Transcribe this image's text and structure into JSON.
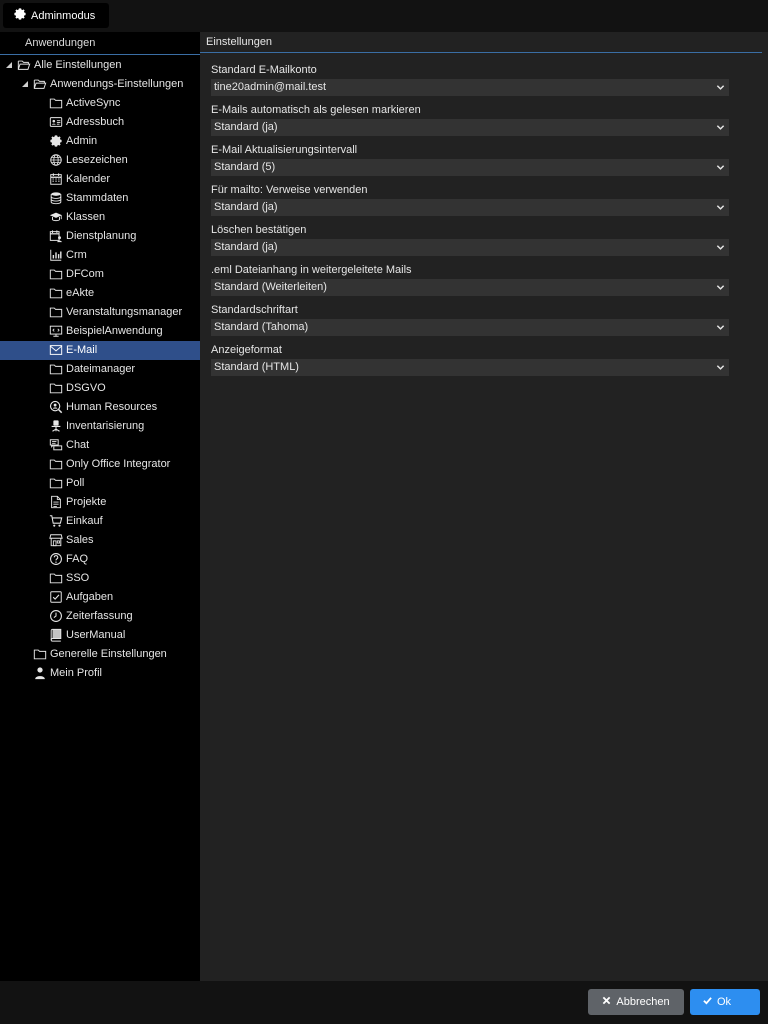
{
  "topbar": {
    "admin_mode_label": "Adminmodus"
  },
  "left_panel": {
    "header": "Anwendungen",
    "tree": [
      {
        "label": "Alle Einstellungen",
        "icon": "folder-open-icon",
        "level": 0,
        "toggle": "expanded"
      },
      {
        "label": "Anwendungs-Einstellungen",
        "icon": "folder-open-icon",
        "level": 1,
        "toggle": "expanded"
      },
      {
        "label": "ActiveSync",
        "icon": "folder-icon",
        "level": 2
      },
      {
        "label": "Adressbuch",
        "icon": "contact-card-icon",
        "level": 2
      },
      {
        "label": "Admin",
        "icon": "gear-icon",
        "level": 2
      },
      {
        "label": "Lesezeichen",
        "icon": "globe-icon",
        "level": 2
      },
      {
        "label": "Kalender",
        "icon": "calendar-icon",
        "level": 2
      },
      {
        "label": "Stammdaten",
        "icon": "database-icon",
        "level": 2
      },
      {
        "label": "Klassen",
        "icon": "graduation-cap-icon",
        "level": 2
      },
      {
        "label": "Dienstplanung",
        "icon": "calendar-person-icon",
        "level": 2
      },
      {
        "label": "Crm",
        "icon": "bar-chart-icon",
        "level": 2
      },
      {
        "label": "DFCom",
        "icon": "folder-icon",
        "level": 2
      },
      {
        "label": "eAkte",
        "icon": "folder-icon",
        "level": 2
      },
      {
        "label": "Veranstaltungsmanager",
        "icon": "folder-icon",
        "level": 2
      },
      {
        "label": "BeispielAnwendung",
        "icon": "code-window-icon",
        "level": 2
      },
      {
        "label": "E-Mail",
        "icon": "envelope-icon",
        "level": 2,
        "selected": true
      },
      {
        "label": "Dateimanager",
        "icon": "folder-icon",
        "level": 2
      },
      {
        "label": "DSGVO",
        "icon": "folder-icon",
        "level": 2
      },
      {
        "label": "Human Resources",
        "icon": "person-search-icon",
        "level": 2
      },
      {
        "label": "Inventarisierung",
        "icon": "office-chair-icon",
        "level": 2
      },
      {
        "label": "Chat",
        "icon": "chat-bubbles-icon",
        "level": 2
      },
      {
        "label": "Only Office Integrator",
        "icon": "folder-icon",
        "level": 2
      },
      {
        "label": "Poll",
        "icon": "folder-icon",
        "level": 2
      },
      {
        "label": "Projekte",
        "icon": "document-icon",
        "level": 2
      },
      {
        "label": "Einkauf",
        "icon": "shopping-cart-icon",
        "level": 2
      },
      {
        "label": "Sales",
        "icon": "store-icon",
        "level": 2
      },
      {
        "label": "FAQ",
        "icon": "question-circle-icon",
        "level": 2
      },
      {
        "label": "SSO",
        "icon": "folder-icon",
        "level": 2
      },
      {
        "label": "Aufgaben",
        "icon": "checkbox-icon",
        "level": 2
      },
      {
        "label": "Zeiterfassung",
        "icon": "clock-icon",
        "level": 2
      },
      {
        "label": "UserManual",
        "icon": "book-icon",
        "level": 2
      },
      {
        "label": "Generelle Einstellungen",
        "icon": "folder-icon",
        "level": 1
      },
      {
        "label": "Mein Profil",
        "icon": "user-icon",
        "level": 1
      }
    ]
  },
  "right_panel": {
    "header": "Einstellungen",
    "fields": [
      {
        "label": "Standard E-Mailkonto",
        "value": "tine20admin@mail.test"
      },
      {
        "label": "E-Mails automatisch als gelesen markieren",
        "value": "Standard (ja)"
      },
      {
        "label": "E-Mail Aktualisierungsintervall",
        "value": "Standard (5)"
      },
      {
        "label": "Für mailto: Verweise verwenden",
        "value": "Standard (ja)"
      },
      {
        "label": "Löschen bestätigen",
        "value": "Standard (ja)"
      },
      {
        "label": ".eml Dateianhang in weitergeleitete Mails",
        "value": "Standard (Weiterleiten)"
      },
      {
        "label": "Standardschriftart",
        "value": "Standard (Tahoma)"
      },
      {
        "label": "Anzeigeformat",
        "value": "Standard (HTML)"
      }
    ]
  },
  "footer": {
    "cancel_label": "Abbrechen",
    "ok_label": "Ok"
  },
  "colors": {
    "selection": "#2f4f8a",
    "ok_button": "#2d8ef0",
    "cancel_button": "#5f6368",
    "header_rule": "#3a6ea5"
  }
}
